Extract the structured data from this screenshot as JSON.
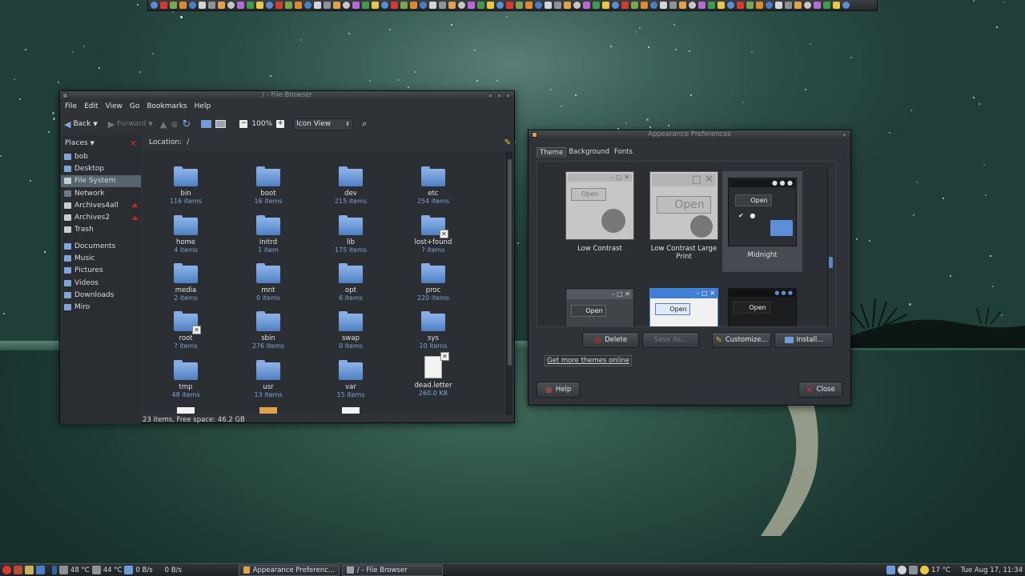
{
  "file_browser": {
    "title": "/ - File Browser",
    "menus": [
      "File",
      "Edit",
      "View",
      "Go",
      "Bookmarks",
      "Help"
    ],
    "toolbar": {
      "back": "Back",
      "forward": "Forward",
      "zoom": "100%",
      "view_mode": "Icon View"
    },
    "places_label": "Places",
    "places": [
      {
        "label": "bob",
        "icon": "home-icon"
      },
      {
        "label": "Desktop",
        "icon": "desktop-icon"
      },
      {
        "label": "File System",
        "icon": "drive-icon",
        "selected": true
      },
      {
        "label": "Network",
        "icon": "network-icon"
      },
      {
        "label": "Archives4all",
        "icon": "drive-icon",
        "eject": true
      },
      {
        "label": "Archives2",
        "icon": "drive-icon",
        "eject": true
      },
      {
        "label": "Trash",
        "icon": "trash-icon"
      },
      {
        "label": "Documents",
        "icon": "folder-icon",
        "group_start": true
      },
      {
        "label": "Music",
        "icon": "folder-icon"
      },
      {
        "label": "Pictures",
        "icon": "folder-icon"
      },
      {
        "label": "Videos",
        "icon": "folder-icon"
      },
      {
        "label": "Downloads",
        "icon": "folder-icon"
      },
      {
        "label": "Miro",
        "icon": "folder-icon"
      }
    ],
    "location_label": "Location:",
    "location_value": "/",
    "items": [
      {
        "name": "bin",
        "info": "116 items",
        "icon": "folder-icon"
      },
      {
        "name": "boot",
        "info": "16 items",
        "icon": "folder-icon"
      },
      {
        "name": "dev",
        "info": "215 items",
        "icon": "folder-icon"
      },
      {
        "name": "etc",
        "info": "254 items",
        "icon": "folder-icon"
      },
      {
        "name": "home",
        "info": "4 items",
        "icon": "folder-icon"
      },
      {
        "name": "initrd",
        "info": "1 item",
        "icon": "folder-icon"
      },
      {
        "name": "lib",
        "info": "175 items",
        "icon": "folder-icon"
      },
      {
        "name": "lost+found",
        "info": "? items",
        "icon": "folder-locked-icon"
      },
      {
        "name": "media",
        "info": "2 items",
        "icon": "folder-icon"
      },
      {
        "name": "mnt",
        "info": "0 items",
        "icon": "folder-icon"
      },
      {
        "name": "opt",
        "info": "6 items",
        "icon": "folder-icon"
      },
      {
        "name": "proc",
        "info": "220 items",
        "icon": "folder-icon"
      },
      {
        "name": "root",
        "info": "? items",
        "icon": "folder-locked-icon"
      },
      {
        "name": "sbin",
        "info": "276 items",
        "icon": "folder-icon"
      },
      {
        "name": "swap",
        "info": "0 items",
        "icon": "folder-icon"
      },
      {
        "name": "sys",
        "info": "10 items",
        "icon": "folder-icon"
      },
      {
        "name": "tmp",
        "info": "48 items",
        "icon": "folder-icon"
      },
      {
        "name": "usr",
        "info": "13 items",
        "icon": "folder-icon"
      },
      {
        "name": "var",
        "info": "15 items",
        "icon": "folder-icon"
      },
      {
        "name": "dead.letter",
        "info": "260.0 KB",
        "icon": "document-locked-icon"
      }
    ],
    "status": "23 items, Free space: 46.2 GB"
  },
  "appearance": {
    "title": "Appearance Preferences",
    "tabs": [
      "Theme",
      "Background",
      "Fonts"
    ],
    "themes": [
      {
        "label": "Low Contrast",
        "style": "light"
      },
      {
        "label": "Low Contrast Large Print",
        "style": "light"
      },
      {
        "label": "Midnight",
        "style": "dark",
        "selected": true
      },
      {
        "label": "",
        "style": "dark-partial"
      },
      {
        "label": "",
        "style": "blue-partial"
      },
      {
        "label": "",
        "style": "black-partial"
      }
    ],
    "preview_open": "Open",
    "buttons": {
      "delete": "Delete",
      "save_as": "Save As...",
      "customize": "Customize...",
      "install": "Install..."
    },
    "get_more": "Get more themes online",
    "help": "Help",
    "close": "Close"
  },
  "panel": {
    "cpu_temp": "48 °C",
    "gpu_temp": "44 °C",
    "net_down": "0 B/s",
    "net_up": "0 B/s",
    "tasks": [
      "Appearance Preferenc...",
      "/ - File Browser"
    ],
    "weather": "17 °C",
    "clock": "Tue Aug 17, 11:34"
  },
  "colors": {
    "accent": "#566470",
    "folder": "#6f9bd8",
    "close_red": "#e0252b"
  }
}
